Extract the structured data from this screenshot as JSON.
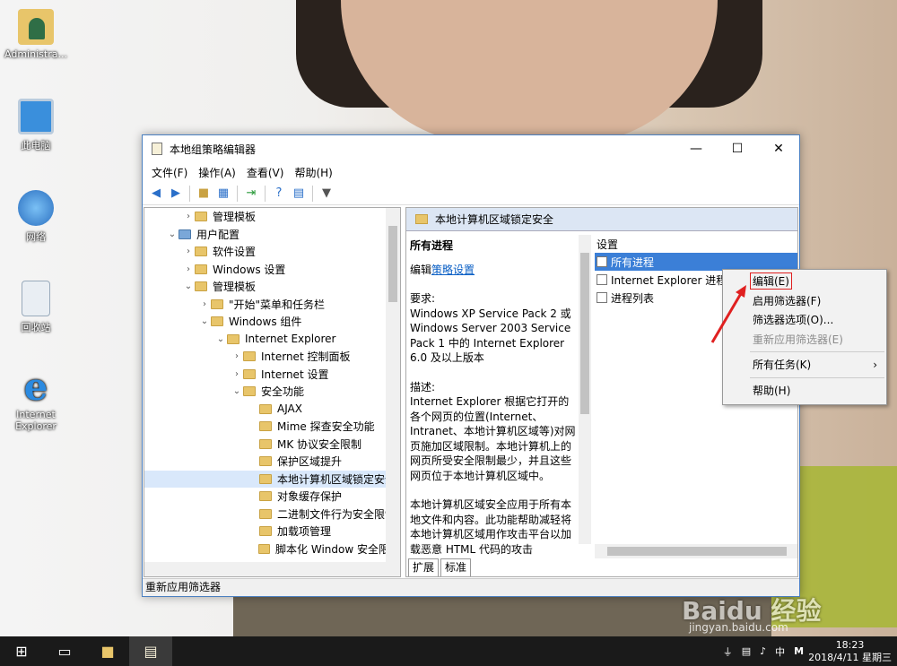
{
  "desktop": {
    "icons": [
      {
        "label": "Administra...",
        "icon": "user-folder-icon"
      },
      {
        "label": "此电脑",
        "icon": "computer-icon"
      },
      {
        "label": "网络",
        "icon": "network-icon"
      },
      {
        "label": "回收站",
        "icon": "recycle-bin-icon"
      },
      {
        "label": "Internet Explorer",
        "icon": "ie-icon"
      }
    ]
  },
  "window": {
    "title": "本地组策略编辑器",
    "menu": [
      "文件(F)",
      "操作(A)",
      "查看(V)",
      "帮助(H)"
    ],
    "tree": [
      {
        "label": "管理模板",
        "indent": 1
      },
      {
        "label": "用户配置",
        "indent": 0
      },
      {
        "label": "软件设置",
        "indent": 1
      },
      {
        "label": "Windows 设置",
        "indent": 1
      },
      {
        "label": "管理模板",
        "indent": 1
      },
      {
        "label": "\"开始\"菜单和任务栏",
        "indent": 2
      },
      {
        "label": "Windows 组件",
        "indent": 2
      },
      {
        "label": "Internet Explorer",
        "indent": 3
      },
      {
        "label": "Internet 控制面板",
        "indent": 4
      },
      {
        "label": "Internet 设置",
        "indent": 4
      },
      {
        "label": "安全功能",
        "indent": 4
      },
      {
        "label": "AJAX",
        "indent": 5
      },
      {
        "label": "Mime 探查安全功能",
        "indent": 5
      },
      {
        "label": "MK 协议安全限制",
        "indent": 5
      },
      {
        "label": "保护区域提升",
        "indent": 5
      },
      {
        "label": "本地计算机区域锁定安全",
        "indent": 5
      },
      {
        "label": "对象缓存保护",
        "indent": 5
      },
      {
        "label": "二进制文件行为安全限制",
        "indent": 5
      },
      {
        "label": "加载项管理",
        "indent": 5
      },
      {
        "label": "脚本化 Window 安全限制",
        "indent": 5
      }
    ],
    "right_header": "本地计算机区域锁定安全",
    "desc": {
      "heading": "所有进程",
      "edit_prefix": "编辑",
      "edit_link": "策略设置",
      "req_label": "要求:",
      "req_text": "Windows XP Service Pack 2 或 Windows Server 2003 Service Pack 1 中的 Internet Explorer 6.0 及以上版本",
      "desc_label": "描述:",
      "desc_text": "Internet Explorer 根据它打开的各个网页的位置(Internet、Intranet、本地计算机区域等)对网页施加区域限制。本地计算机上的网页所受安全限制最少，并且这些网页位于本地计算机区域中。",
      "desc_text2": "本地计算机区域安全应用于所有本地文件和内容。此功能帮助减轻将本地计算机区域用作攻击平台以加载恶意 HTML 代码的攻击"
    },
    "list": {
      "header": "设置",
      "items": [
        "所有进程",
        "Internet Explorer 进程",
        "进程列表"
      ]
    },
    "tabs": [
      "扩展",
      "标准"
    ],
    "status": "重新应用筛选器"
  },
  "context_menu": {
    "items": [
      {
        "label": "编辑(E)",
        "disabled": false
      },
      {
        "label": "启用筛选器(F)",
        "disabled": false
      },
      {
        "label": "筛选器选项(O)...",
        "disabled": false
      },
      {
        "label": "重新应用筛选器(E)",
        "disabled": true
      },
      {
        "label": "所有任务(K)",
        "disabled": false,
        "submenu": true
      },
      {
        "label": "帮助(H)",
        "disabled": false
      }
    ]
  },
  "taskbar": {
    "tray_icons": [
      "usb-icon",
      "network-tray-icon",
      "volume-icon"
    ],
    "ime": "中",
    "ime2": "M",
    "time": "18:23",
    "date": "2018/4/11 星期三"
  },
  "watermark": {
    "brand": "Baidu 经验",
    "url": "jingyan.baidu.com"
  },
  "colors": {
    "accent": "#3b7fd7",
    "highlight_box": "#e02020",
    "arrow": "#e02020"
  }
}
